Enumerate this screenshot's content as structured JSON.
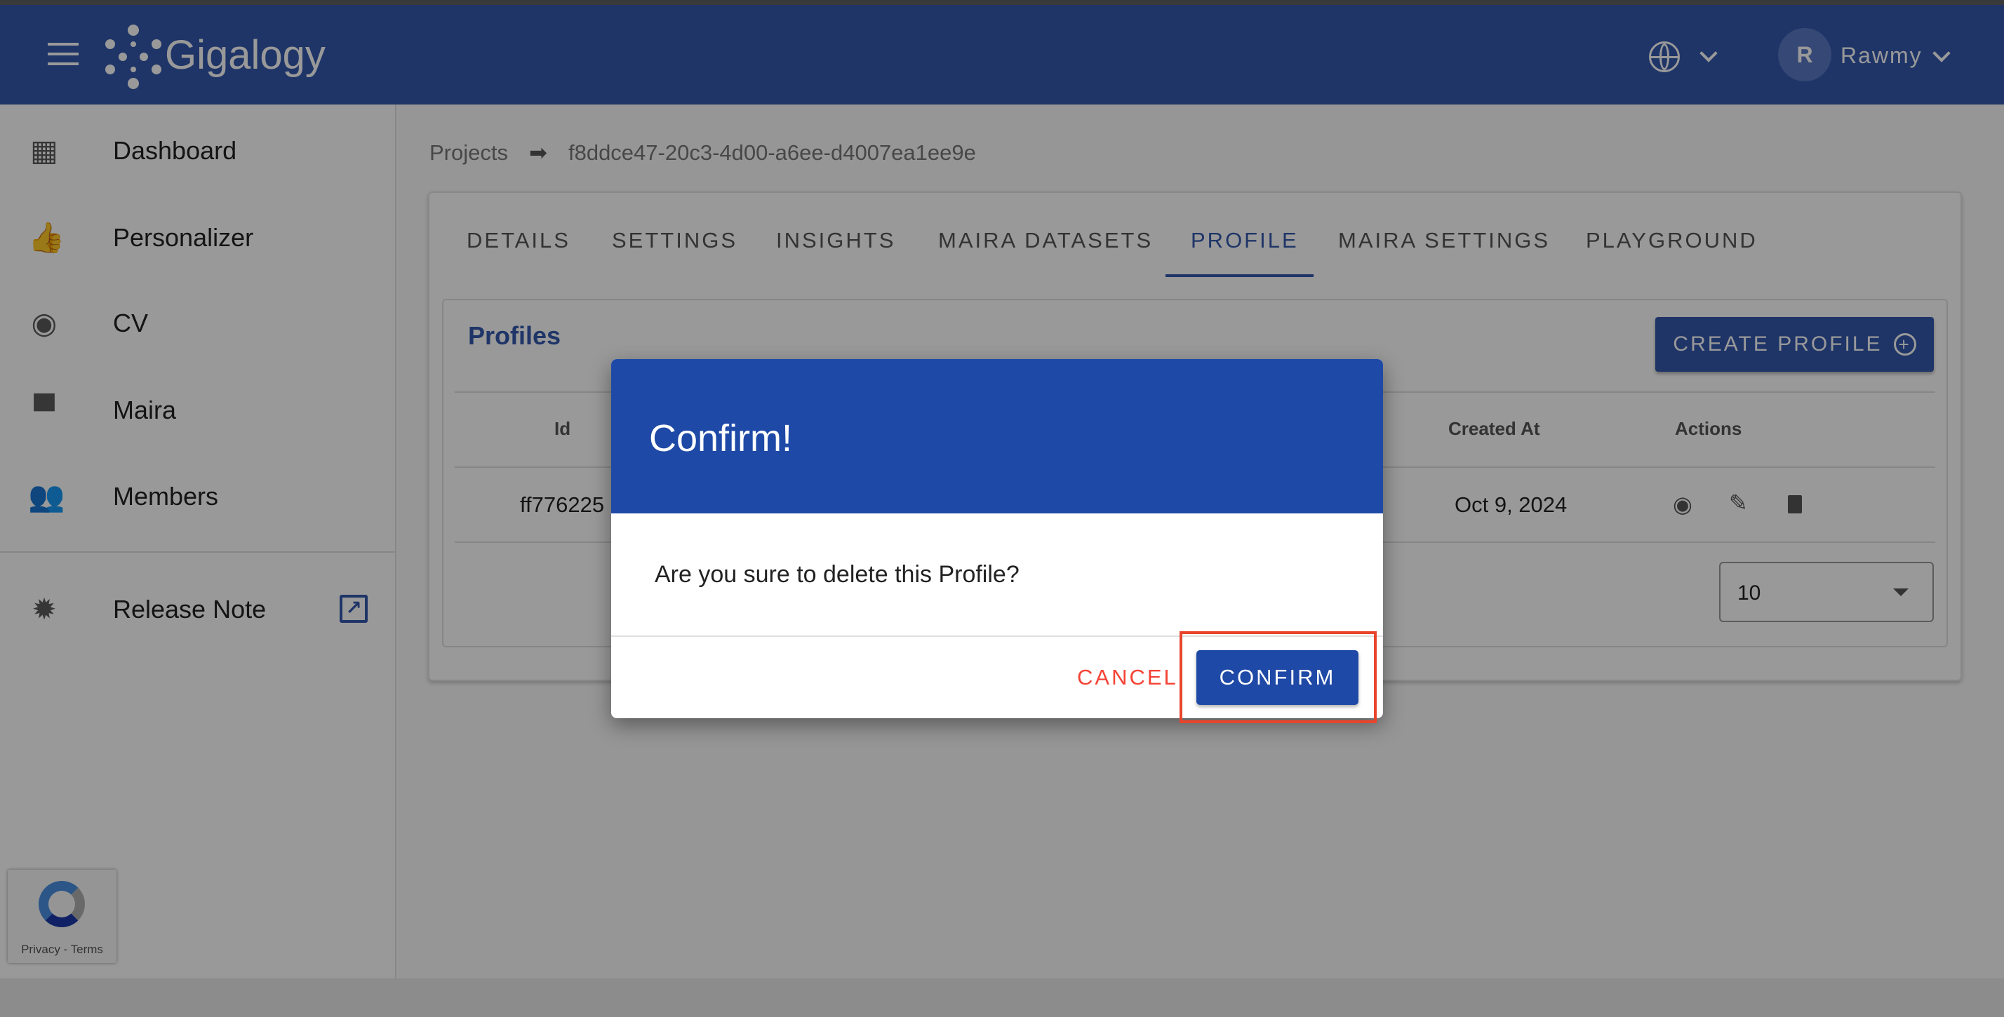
{
  "header": {
    "brand": "Gigalogy",
    "user_initial": "R",
    "user_name": "Rawmy",
    "color": "#3459ad"
  },
  "sidebar": {
    "items": [
      {
        "label": "Dashboard",
        "icon": "dashboard-icon"
      },
      {
        "label": "Personalizer",
        "icon": "thumb-up-icon"
      },
      {
        "label": "CV",
        "icon": "eye-icon"
      },
      {
        "label": "Maira",
        "icon": "chat-icon"
      },
      {
        "label": "Members",
        "icon": "people-icon"
      },
      {
        "label": "Release Note",
        "icon": "alert-badge-icon"
      }
    ]
  },
  "breadcrumb": {
    "root": "Projects",
    "current": "f8ddce47-20c3-4d00-a6ee-d4007ea1ee9e"
  },
  "tabs": [
    "DETAILS",
    "SETTINGS",
    "INSIGHTS",
    "MAIRA DATASETS",
    "PROFILE",
    "MAIRA SETTINGS",
    "PLAYGROUND"
  ],
  "active_tab": "PROFILE",
  "profiles": {
    "title": "Profiles",
    "create_label": "CREATE PROFILE",
    "columns": {
      "id": "Id",
      "created_at": "Created At",
      "actions": "Actions"
    },
    "rows": [
      {
        "id": "ff776225",
        "created_at": "Oct 9, 2024"
      }
    ],
    "per_page": "10"
  },
  "dialog": {
    "title": "Confirm!",
    "message": "Are you sure to delete this Profile?",
    "cancel": "CANCEL",
    "confirm": "CONFIRM",
    "header_color": "#1e49a6",
    "cancel_color": "#f44336"
  },
  "recaptcha": {
    "text": "Privacy - Terms"
  }
}
